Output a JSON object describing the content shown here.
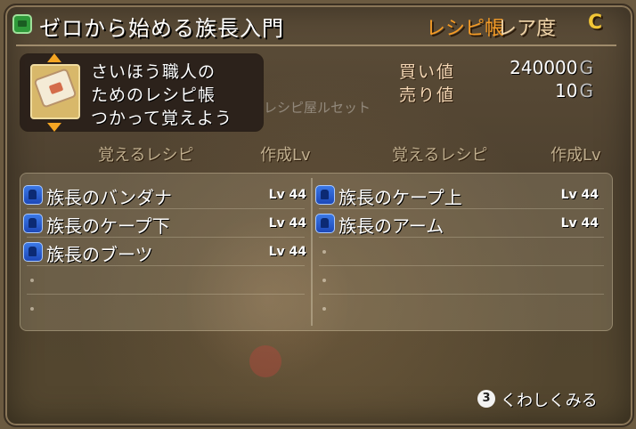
{
  "header": {
    "title": "ゼロから始める族長入門",
    "type_label": "レシピ帳",
    "rarity_label": "レア度",
    "rarity_value": "C"
  },
  "description": {
    "lines": [
      "さいほう職人の",
      "ためのレシピ帳",
      "つかって覚えよう"
    ]
  },
  "prices": {
    "buy_label": "買い値",
    "buy_value": "240000",
    "sell_label": "売り値",
    "sell_value": "10",
    "unit": "G"
  },
  "faint_label": "レシピ屋ルセット",
  "columns": {
    "recipe_header": "覚えるレシピ",
    "level_header": "作成Lv"
  },
  "recipes_left": [
    {
      "name": "族長のバンダナ",
      "level": "Lv 44",
      "icon": "bandana-icon"
    },
    {
      "name": "族長のケープ下",
      "level": "Lv 44",
      "icon": "cape-lower-icon"
    },
    {
      "name": "族長のブーツ",
      "level": "Lv 44",
      "icon": "boots-icon"
    }
  ],
  "recipes_right": [
    {
      "name": "族長のケープ上",
      "level": "Lv 44",
      "icon": "cape-upper-icon"
    },
    {
      "name": "族長のアーム",
      "level": "Lv 44",
      "icon": "arm-icon"
    }
  ],
  "footer": {
    "button_label": "3",
    "hint_text": "くわしくみる"
  },
  "colors": {
    "type_label": "#f39a25",
    "rarity_value": "#f2c636",
    "accent_arrow": "#f5a623"
  }
}
